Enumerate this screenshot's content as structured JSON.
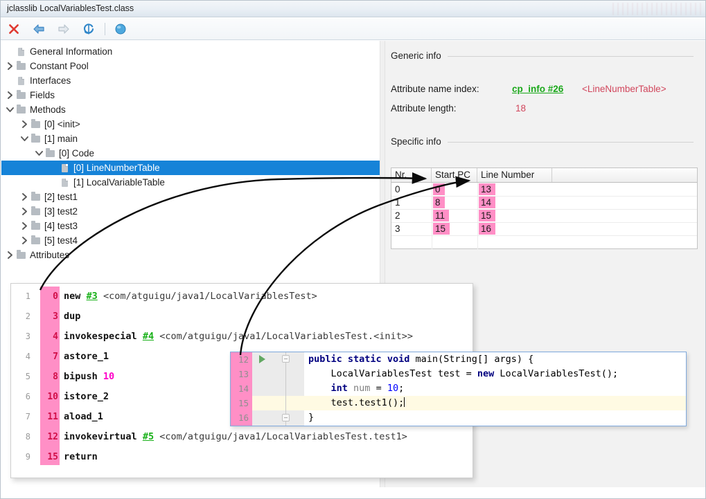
{
  "window": {
    "title": "jclasslib LocalVariablesTest.class"
  },
  "toolbar": {
    "buttons": [
      {
        "name": "close-icon",
        "label": "Close",
        "glyph": "✕",
        "color": "#e03b32",
        "enabled": true
      },
      {
        "name": "back-icon",
        "label": "Back",
        "glyph": "⇦",
        "color": "#3f87c6",
        "enabled": true
      },
      {
        "name": "forward-icon",
        "label": "Forward",
        "glyph": "⇨",
        "color": "#b9c4cd",
        "enabled": false
      },
      {
        "name": "reload-icon",
        "label": "Reload",
        "glyph": "↺",
        "color": "#2f86c9",
        "enabled": true
      },
      {
        "name": "browse-icon",
        "label": "Browse",
        "glyph": "●",
        "color": "#49a7dd",
        "enabled": true
      }
    ]
  },
  "tree": {
    "items": [
      {
        "label": "General Information",
        "indent": 1,
        "twisty": "",
        "icon": "file",
        "selected": false
      },
      {
        "label": "Constant Pool",
        "indent": 1,
        "twisty": ">",
        "icon": "folder",
        "selected": false
      },
      {
        "label": "Interfaces",
        "indent": 1,
        "twisty": "",
        "icon": "file",
        "selected": false
      },
      {
        "label": "Fields",
        "indent": 1,
        "twisty": ">",
        "icon": "folder",
        "selected": false
      },
      {
        "label": "Methods",
        "indent": 1,
        "twisty": "v",
        "icon": "folder",
        "selected": false
      },
      {
        "label": "[0] <init>",
        "indent": 2,
        "twisty": ">",
        "icon": "folder",
        "selected": false
      },
      {
        "label": "[1] main",
        "indent": 2,
        "twisty": "v",
        "icon": "folder",
        "selected": false
      },
      {
        "label": "[0] Code",
        "indent": 3,
        "twisty": "v",
        "icon": "folder",
        "selected": false
      },
      {
        "label": "[0] LineNumberTable",
        "indent": 4,
        "twisty": "",
        "icon": "file",
        "selected": true
      },
      {
        "label": "[1] LocalVariableTable",
        "indent": 4,
        "twisty": "",
        "icon": "file",
        "selected": false
      },
      {
        "label": "[2] test1",
        "indent": 2,
        "twisty": ">",
        "icon": "folder",
        "selected": false
      },
      {
        "label": "[3] test2",
        "indent": 2,
        "twisty": ">",
        "icon": "folder",
        "selected": false
      },
      {
        "label": "[4] test3",
        "indent": 2,
        "twisty": ">",
        "icon": "folder",
        "selected": false
      },
      {
        "label": "[5] test4",
        "indent": 2,
        "twisty": ">",
        "icon": "folder",
        "selected": false
      },
      {
        "label": "Attributes",
        "indent": 1,
        "twisty": ">",
        "icon": "folder",
        "selected": false
      }
    ]
  },
  "detail": {
    "generic_title": "Generic info",
    "specific_title": "Specific info",
    "attribute_name_index_label": "Attribute name index:",
    "attribute_name_index_value": "cp_info #26",
    "attribute_name_index_resolved": "<LineNumberTable>",
    "attribute_length_label": "Attribute length:",
    "attribute_length_value": "18"
  },
  "table": {
    "columns": [
      "Nr.",
      "Start PC",
      "Line Number"
    ],
    "rows": [
      {
        "nr": "0",
        "start_pc": "0",
        "line_number": "13"
      },
      {
        "nr": "1",
        "start_pc": "8",
        "line_number": "14"
      },
      {
        "nr": "2",
        "start_pc": "11",
        "line_number": "15"
      },
      {
        "nr": "3",
        "start_pc": "15",
        "line_number": "16"
      }
    ],
    "highlight_color": "#ff8fc6"
  },
  "bytecode": {
    "lines": [
      {
        "n": "1",
        "offset": "0",
        "op": "new",
        "ref": "#3",
        "desc": "<com/atguigu/java1/LocalVariablesTest>",
        "lit": ""
      },
      {
        "n": "2",
        "offset": "3",
        "op": "dup",
        "ref": "",
        "desc": "",
        "lit": ""
      },
      {
        "n": "3",
        "offset": "4",
        "op": "invokespecial",
        "ref": "#4",
        "desc": "<com/atguigu/java1/LocalVariablesTest.<init>>",
        "lit": ""
      },
      {
        "n": "4",
        "offset": "7",
        "op": "astore_1",
        "ref": "",
        "desc": "",
        "lit": ""
      },
      {
        "n": "5",
        "offset": "8",
        "op": "bipush",
        "ref": "",
        "desc": "",
        "lit": "10"
      },
      {
        "n": "6",
        "offset": "10",
        "op": "istore_2",
        "ref": "",
        "desc": "",
        "lit": ""
      },
      {
        "n": "7",
        "offset": "11",
        "op": "aload_1",
        "ref": "",
        "desc": "",
        "lit": ""
      },
      {
        "n": "8",
        "offset": "12",
        "op": "invokevirtual",
        "ref": "#5",
        "desc": "<com/atguigu/java1/LocalVariablesTest.test1>",
        "lit": ""
      },
      {
        "n": "9",
        "offset": "15",
        "op": "return",
        "ref": "",
        "desc": "",
        "lit": ""
      }
    ]
  },
  "editor": {
    "lines": [
      {
        "num": "12",
        "text": "public static void main(String[] args) {",
        "current": false
      },
      {
        "num": "13",
        "text": "    LocalVariablesTest test = new LocalVariablesTest();",
        "current": false
      },
      {
        "num": "14",
        "text": "    int num = 10;",
        "current": false
      },
      {
        "num": "15",
        "text": "    test.test1();",
        "current": true
      },
      {
        "num": "16",
        "text": "}",
        "current": false
      }
    ]
  },
  "annotations": {
    "arrow1": "offset-column-to-start-pc-column",
    "arrow2": "editor-line-numbers-to-line-number-column"
  }
}
